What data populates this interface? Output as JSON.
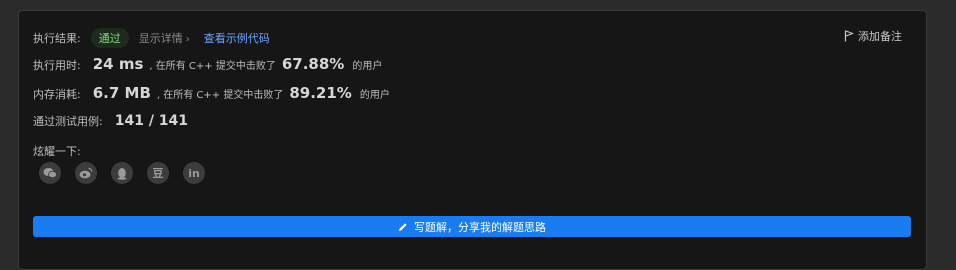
{
  "result": {
    "label": "执行结果:",
    "status": "通过",
    "details": "显示详情",
    "sample_link": "查看示例代码",
    "add_note": "添加备注"
  },
  "runtime": {
    "label": "执行用时:",
    "value": "24 ms",
    "middle": ", 在所有 C++ 提交中击败了",
    "percent": "67.88%",
    "suffix": "的用户"
  },
  "memory": {
    "label": "内存消耗:",
    "value": "6.7 MB",
    "middle": ", 在所有 C++ 提交中击败了",
    "percent": "89.21%",
    "suffix": "的用户"
  },
  "tests": {
    "label": "通过测试用例:",
    "value": "141 / 141"
  },
  "share": {
    "title": "炫耀一下:",
    "icons": [
      "wechat-icon",
      "weibo-icon",
      "qq-icon",
      "douban-icon",
      "linkedin-icon"
    ],
    "douban_glyph": "豆",
    "linkedin_glyph": "in"
  },
  "cta": {
    "label": "写题解，分享我的解题思路"
  },
  "colors": {
    "accent": "#1a7cf2",
    "pass": "#7ee07b",
    "link": "#6aa6ff"
  }
}
